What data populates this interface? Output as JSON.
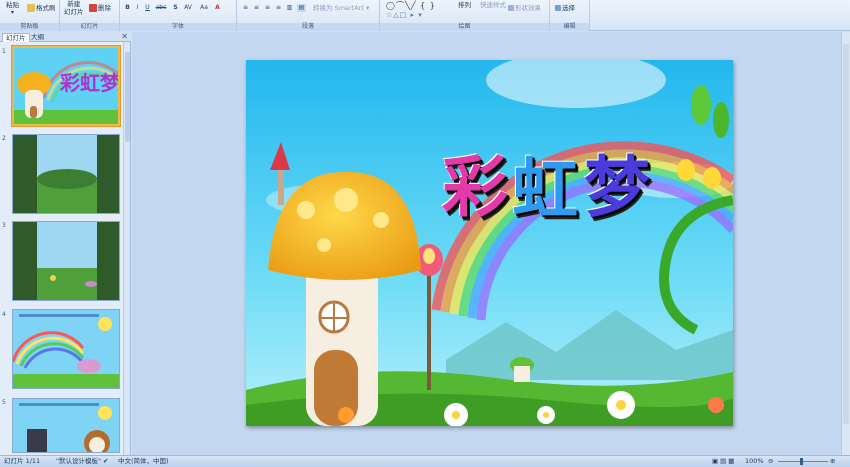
{
  "ribbon": {
    "groups": {
      "clipboard": "剪贴板",
      "slides": "幻灯片",
      "font": "字体",
      "paragraph": "段落",
      "drawing": "绘图",
      "editing": "编辑"
    },
    "paste": "粘贴",
    "format_painter": "格式刷",
    "new_slide_line1": "新建",
    "new_slide_line2": "幻灯片",
    "delete": "删除",
    "convert_smartart": "转换为 SmartArt",
    "arrange": "排列",
    "quick_styles": "快速样式",
    "shape_effects": "形状效果",
    "select": "选择"
  },
  "panel": {
    "tabs": [
      "幻灯片",
      "大纲"
    ],
    "thumbnails": [
      {
        "num": "1",
        "selected": true
      },
      {
        "num": "2",
        "selected": false
      },
      {
        "num": "3",
        "selected": false
      },
      {
        "num": "4",
        "selected": false
      },
      {
        "num": "5",
        "selected": false
      }
    ]
  },
  "slide": {
    "title_chars": [
      "彩",
      "虹",
      "梦"
    ]
  },
  "status": {
    "slide_info": "幻灯片 1/11",
    "theme": "\"默认设计模板\"",
    "language": "中文(简体，中国)",
    "zoom": "100%"
  },
  "colors": {
    "sky": "#39c9f0",
    "grass": "#5fc23a",
    "mushroom_cap": "#f5b21f",
    "ribbon_bg": "#dce8f7"
  }
}
